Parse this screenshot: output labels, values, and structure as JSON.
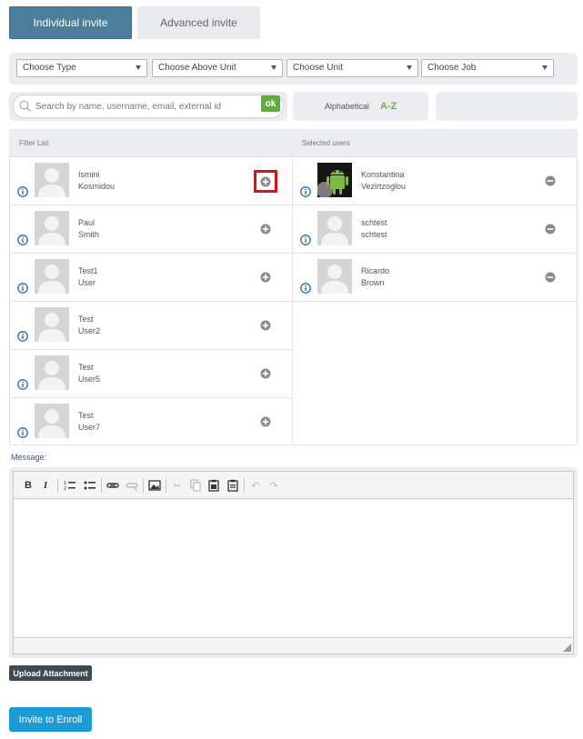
{
  "tabs": {
    "individual": "Individual invite",
    "advanced": "Advanced invite"
  },
  "filters": {
    "type": "Choose Type",
    "above_unit": "Choose Above Unit",
    "unit": "Choose Unit",
    "job": "Choose Job"
  },
  "search": {
    "placeholder": "Search by name, username, email, external id",
    "ok_label": "ok"
  },
  "sort": {
    "label": "Alphabetical",
    "az": "A-Z"
  },
  "filter_list": {
    "header": "Filter List",
    "users": [
      {
        "first": "Ismini",
        "last": "Kosmidou"
      },
      {
        "first": "Paul",
        "last": "Smith"
      },
      {
        "first": "Test1",
        "last": "User"
      },
      {
        "first": "Test",
        "last": "User2"
      },
      {
        "first": "Test",
        "last": "User5"
      },
      {
        "first": "Test",
        "last": "User7"
      }
    ]
  },
  "selected_list": {
    "header": "Selected users",
    "users": [
      {
        "first": "Konstantina",
        "last": "Vezirtzoglou"
      },
      {
        "first": "schtest",
        "last": "schtest"
      },
      {
        "first": "Ricardo",
        "last": "Brown"
      }
    ]
  },
  "message": {
    "label": "Message:"
  },
  "buttons": {
    "upload": "Upload Attachment",
    "invite": "Invite to Enroll"
  },
  "colors": {
    "accent": "#1d9ad8",
    "tab_active": "#4c7d9b",
    "ok_green": "#5eac3b",
    "info_blue": "#2e6da4",
    "highlight": "#e01010"
  }
}
